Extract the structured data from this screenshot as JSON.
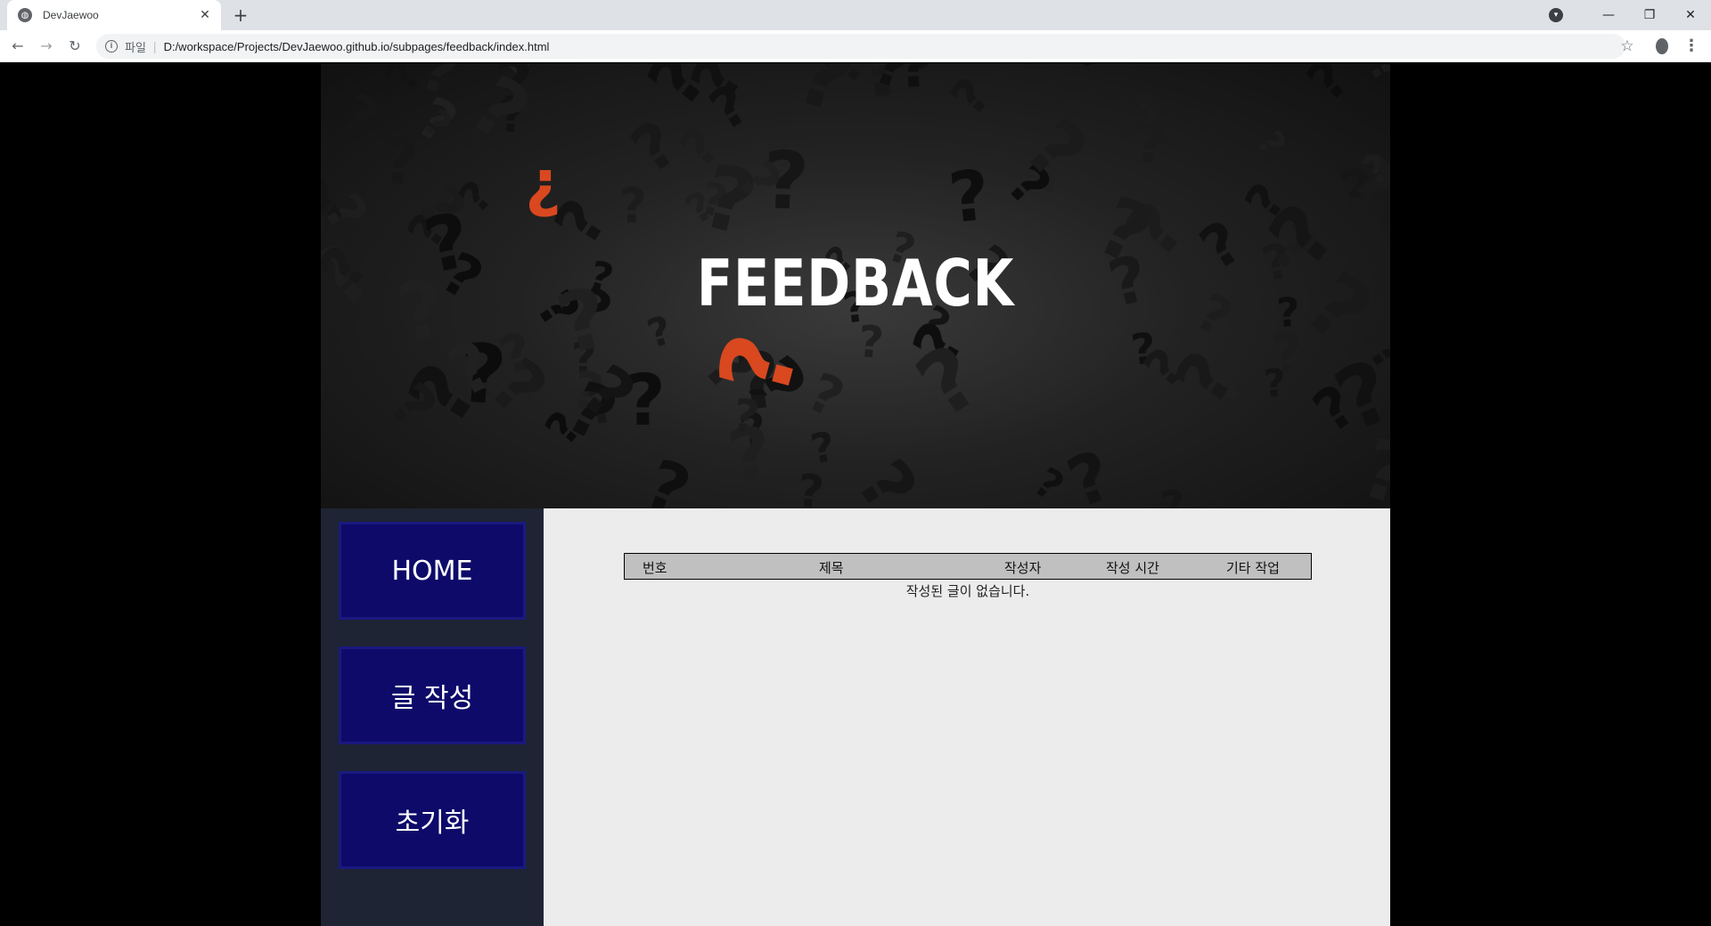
{
  "browser": {
    "tab_title": "DevJaewoo",
    "scheme_label": "파일",
    "url": "D:/workspace/Projects/DevJaewoo.github.io/subpages/feedback/index.html"
  },
  "hero": {
    "title": "FEEDBACK"
  },
  "sidebar": {
    "items": [
      {
        "label": "HOME"
      },
      {
        "label": "글 작성"
      },
      {
        "label": "초기화"
      }
    ]
  },
  "board": {
    "columns": [
      "번호",
      "제목",
      "작성자",
      "작성 시간",
      "기타 작업"
    ],
    "empty_message": "작성된 글이 없습니다."
  },
  "colors": {
    "sidebar_button": "#0d0a6a",
    "sidebar_bg": "#1e2433",
    "content_bg": "#ececec",
    "table_header": "#c0c0c0",
    "accent_question": "#d9481f"
  }
}
